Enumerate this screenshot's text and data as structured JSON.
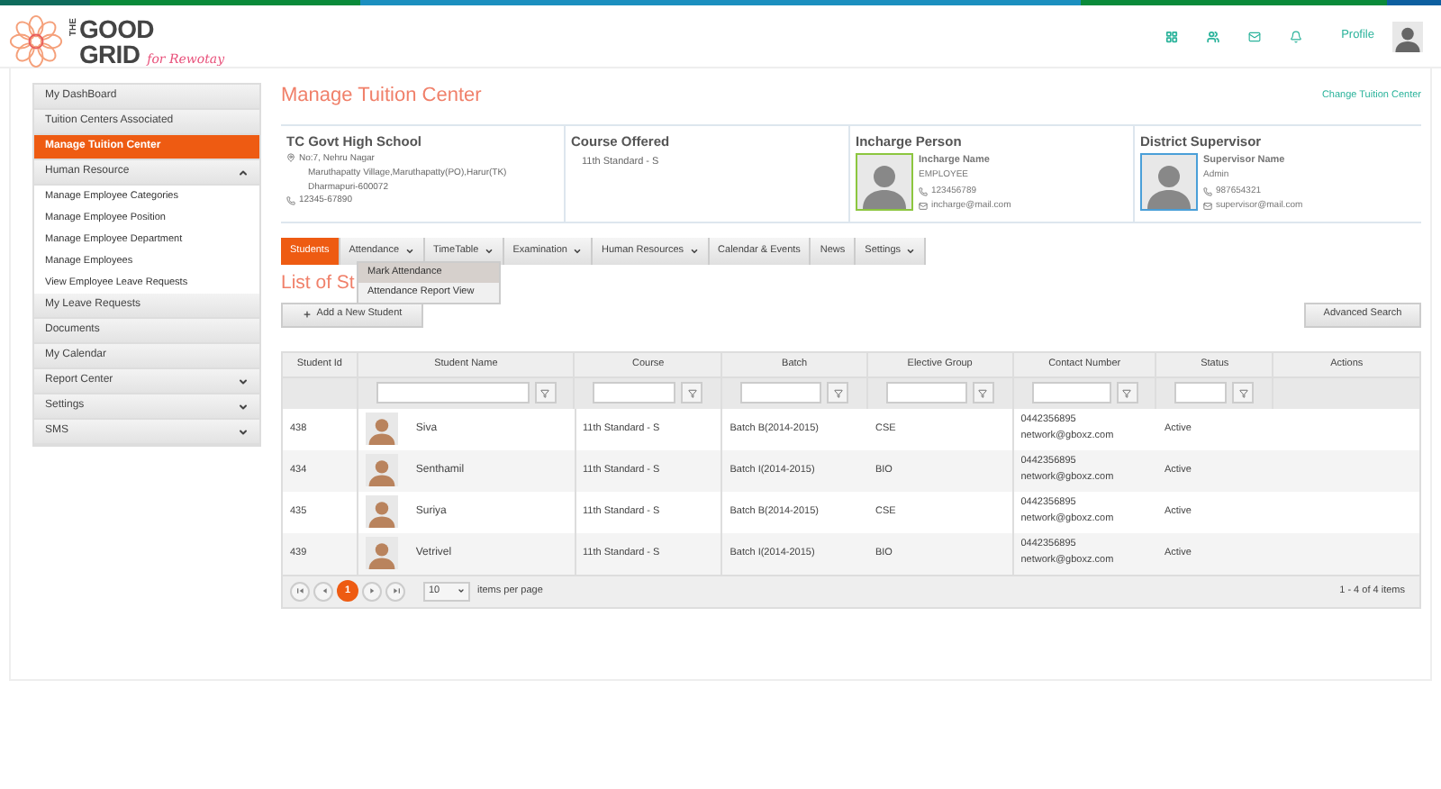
{
  "logo": {
    "small": "THE",
    "line1": "GOOD",
    "line2": "GRID",
    "tagline": "for Rewotay"
  },
  "header": {
    "profile": "Profile"
  },
  "sidebar": {
    "items": [
      {
        "label": "My DashBoard",
        "kind": "link",
        "selected": false
      },
      {
        "label": "Tuition Centers Associated",
        "kind": "link",
        "selected": false
      },
      {
        "label": "Manage Tuition Center",
        "kind": "link",
        "selected": true
      },
      {
        "label": "Human Resource",
        "kind": "group",
        "selected": false,
        "expanded": true,
        "children": [
          {
            "label": "Manage Employee Categories"
          },
          {
            "label": "Manage Employee Position"
          },
          {
            "label": "Manage Employee Department"
          },
          {
            "label": "Manage Employees"
          },
          {
            "label": "View Employee Leave Requests"
          }
        ]
      },
      {
        "label": "My Leave Requests",
        "kind": "link",
        "selected": false
      },
      {
        "label": "Documents",
        "kind": "link",
        "selected": false
      },
      {
        "label": "My Calendar",
        "kind": "link",
        "selected": false
      },
      {
        "label": "Report Center",
        "kind": "group",
        "selected": false,
        "expanded": false
      },
      {
        "label": "Settings",
        "kind": "group",
        "selected": false,
        "expanded": false
      },
      {
        "label": "SMS",
        "kind": "group",
        "selected": false,
        "expanded": false
      }
    ]
  },
  "page": {
    "title": "Manage Tuition Center",
    "change_link": "Change Tuition Center"
  },
  "info": {
    "school": {
      "name": "TC Govt High School",
      "address": [
        "No:7, Nehru Nagar",
        "Maruthapatty Village,Maruthapatty(PO),Harur(TK)",
        "Dharmapuri-600072"
      ],
      "phone": "12345-67890"
    },
    "course": {
      "heading": "Course Offered",
      "value": "11th Standard - S"
    },
    "people": [
      {
        "heading": "Incharge Person",
        "name": "Incharge Name",
        "role": "EMPLOYEE",
        "phone": "123456789",
        "email": "incharge@mail.com",
        "color": "#8cc63f"
      },
      {
        "heading": "District Supervisor",
        "name": "Supervisor Name",
        "role": "Admin",
        "phone": "987654321",
        "email": "supervisor@mail.com",
        "color": "#4a9fd8"
      }
    ]
  },
  "tabs": [
    {
      "label": "Students",
      "kind": "plain",
      "selected": true
    },
    {
      "label": "Attendance",
      "kind": "menu",
      "selected": false
    },
    {
      "label": "TimeTable",
      "kind": "menu",
      "selected": false
    },
    {
      "label": "Examination",
      "kind": "menu",
      "selected": false
    },
    {
      "label": "Human Resources",
      "kind": "menu",
      "selected": false
    },
    {
      "label": "Calendar & Events",
      "kind": "plain",
      "selected": false
    },
    {
      "label": "News",
      "kind": "plain",
      "selected": false
    },
    {
      "label": "Settings",
      "kind": "menu",
      "selected": false
    }
  ],
  "dropdown": {
    "items": [
      {
        "label": "Mark Attendance",
        "selected": true
      },
      {
        "label": "Attendance Report View",
        "selected": false
      }
    ]
  },
  "list": {
    "heading": "List of St",
    "add_button": "Add a New Student",
    "search_button": "Advanced Search"
  },
  "table": {
    "columns": [
      {
        "label": "Student Id",
        "filter": false
      },
      {
        "label": "Student Name",
        "filter": true
      },
      {
        "label": "Course",
        "filter": true
      },
      {
        "label": "Batch",
        "filter": true
      },
      {
        "label": "Elective Group",
        "filter": true
      },
      {
        "label": "Contact Number",
        "filter": true
      },
      {
        "label": "Status",
        "filter": true
      },
      {
        "label": "Actions",
        "filter": false
      }
    ],
    "rows": [
      {
        "id": "438",
        "name": "Siva",
        "course": "11th Standard - S",
        "batch": "Batch B(2014-2015)",
        "group": "CSE",
        "phone": "0442356895",
        "email": "network@gboxz.com",
        "status": "Active"
      },
      {
        "id": "434",
        "name": "Senthamil",
        "course": "11th Standard - S",
        "batch": "Batch I(2014-2015)",
        "group": "BIO",
        "phone": "0442356895",
        "email": "network@gboxz.com",
        "status": "Active"
      },
      {
        "id": "435",
        "name": "Suriya",
        "course": "11th Standard - S",
        "batch": "Batch B(2014-2015)",
        "group": "CSE",
        "phone": "0442356895",
        "email": "network@gboxz.com",
        "status": "Active"
      },
      {
        "id": "439",
        "name": "Vetrivel",
        "course": "11th Standard - S",
        "batch": "Batch I(2014-2015)",
        "group": "BIO",
        "phone": "0442356895",
        "email": "network@gboxz.com",
        "status": "Active"
      }
    ]
  },
  "pager": {
    "pages": [
      {
        "label": "1",
        "selected": true
      }
    ],
    "page_size": "10",
    "per_page_label": "items per page",
    "summary": "1 - 4 of 4 items"
  }
}
